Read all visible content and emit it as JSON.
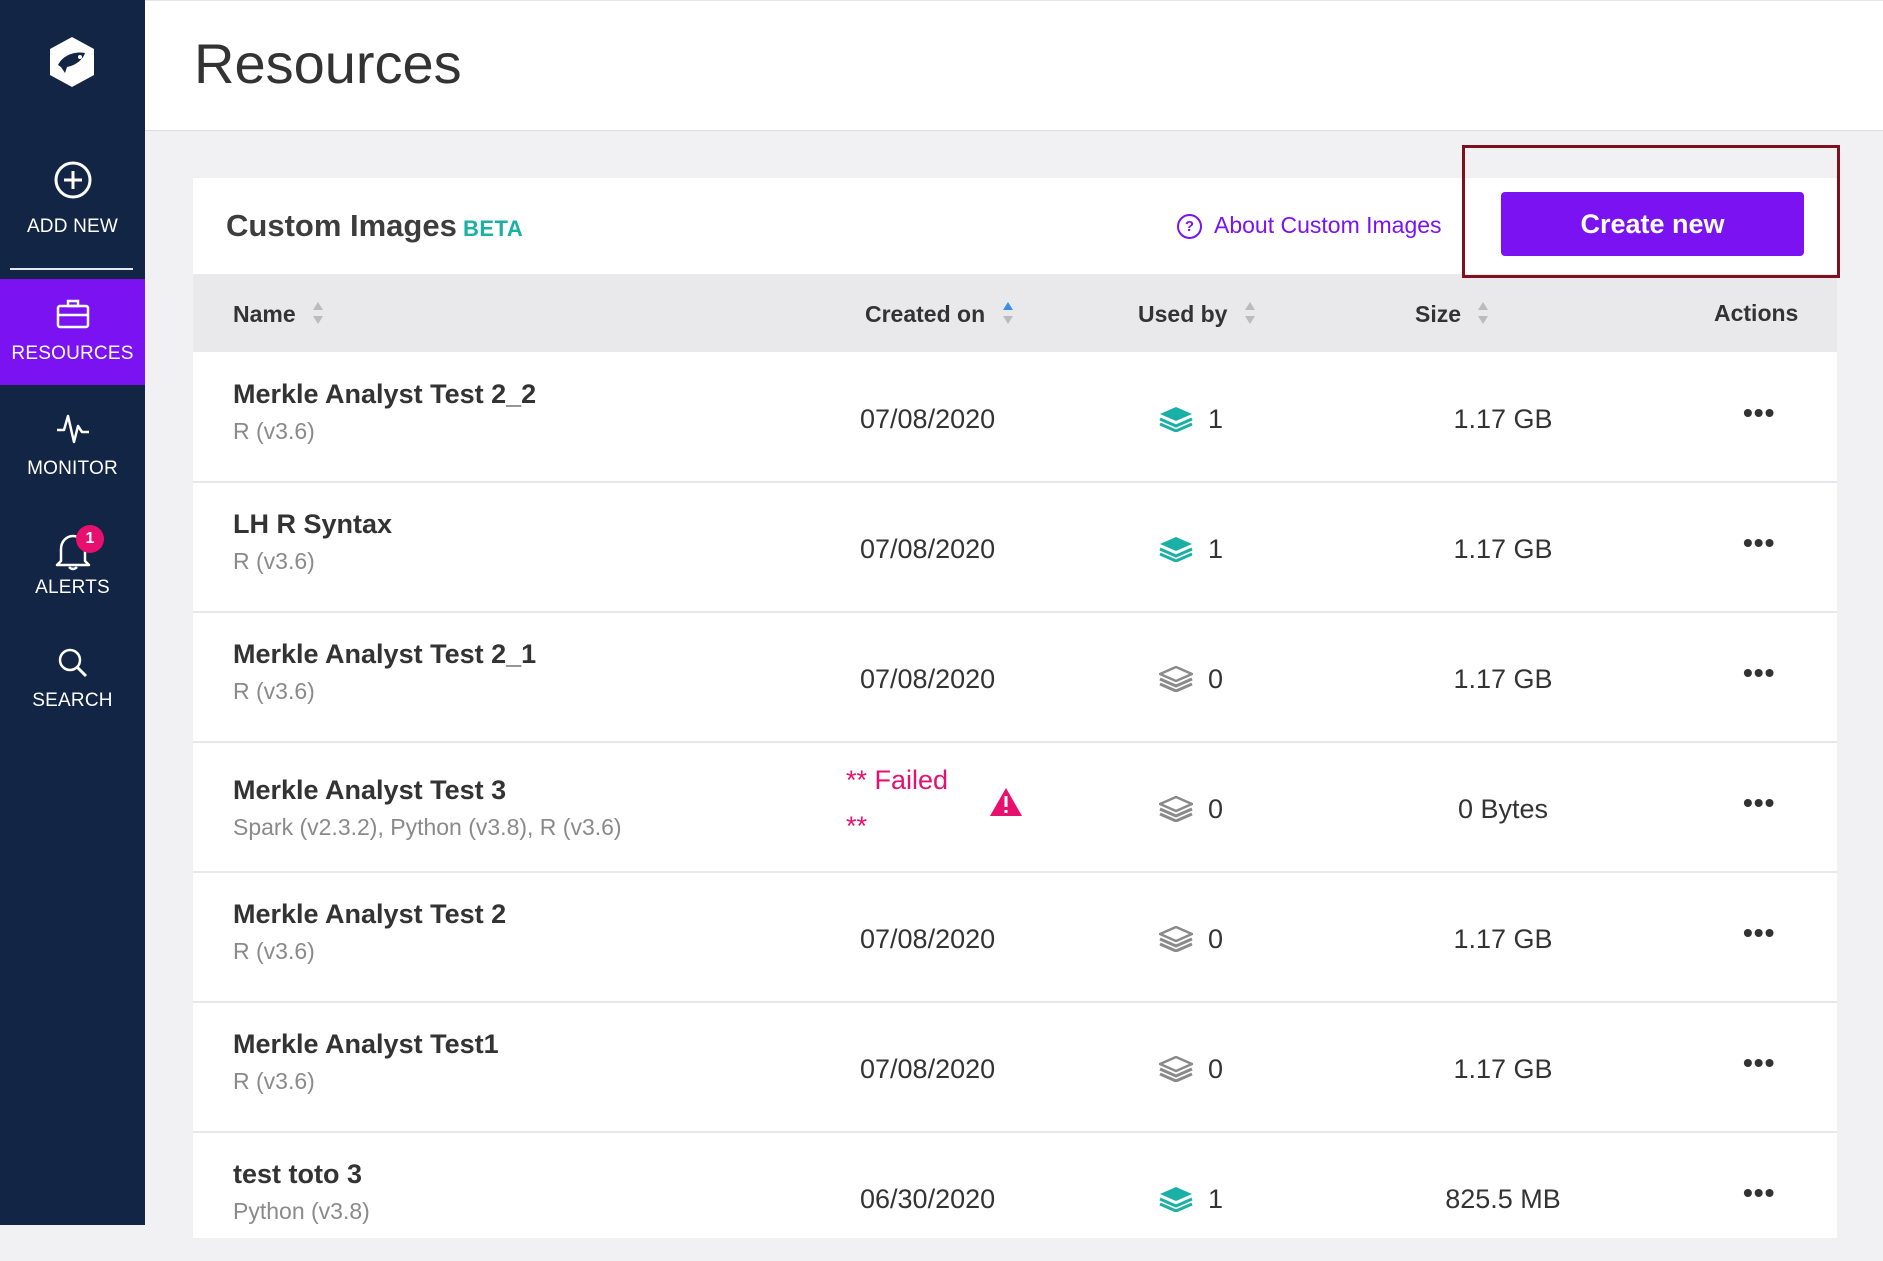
{
  "sidebar": {
    "items": [
      {
        "label": "ADD NEW",
        "icon": "plus-circle-icon"
      },
      {
        "label": "RESOURCES",
        "icon": "briefcase-icon",
        "active": true
      },
      {
        "label": "MONITOR",
        "icon": "pulse-icon"
      },
      {
        "label": "ALERTS",
        "icon": "bell-icon",
        "badge": "1"
      },
      {
        "label": "SEARCH",
        "icon": "search-icon"
      }
    ]
  },
  "header": {
    "title": "Resources"
  },
  "card": {
    "title": "Custom Images",
    "badge": "BETA",
    "about_link": "About Custom Images",
    "create_button": "Create new"
  },
  "table": {
    "columns": [
      "Name",
      "Created on",
      "Used by",
      "Size",
      "Actions"
    ],
    "rows": [
      {
        "name": "Merkle Analyst Test 2_2",
        "sub": "R (v3.6)",
        "created": "07/08/2020",
        "used_by": "1",
        "in_use": true,
        "size": "1.17 GB",
        "actions": "•••"
      },
      {
        "name": "LH R Syntax",
        "sub": "R (v3.6)",
        "created": "07/08/2020",
        "used_by": "1",
        "in_use": true,
        "size": "1.17 GB",
        "actions": "•••"
      },
      {
        "name": "Merkle Analyst Test 2_1",
        "sub": "R (v3.6)",
        "created": "07/08/2020",
        "used_by": "0",
        "in_use": false,
        "size": "1.17 GB",
        "actions": "•••"
      },
      {
        "name": "Merkle Analyst Test 3",
        "sub": "Spark (v2.3.2), Python (v3.8), R (v3.6)",
        "created": "",
        "status_line1": "** Failed",
        "status_line2": "**",
        "used_by": "0",
        "in_use": false,
        "size": "0 Bytes",
        "actions": "•••"
      },
      {
        "name": "Merkle Analyst Test 2",
        "sub": "R (v3.6)",
        "created": "07/08/2020",
        "used_by": "0",
        "in_use": false,
        "size": "1.17 GB",
        "actions": "•••"
      },
      {
        "name": "Merkle Analyst Test1",
        "sub": "R (v3.6)",
        "created": "07/08/2020",
        "used_by": "0",
        "in_use": false,
        "size": "1.17 GB",
        "actions": "•••"
      },
      {
        "name": "test toto 3",
        "sub": "Python (v3.8)",
        "created": "06/30/2020",
        "used_by": "1",
        "in_use": true,
        "size": "825.5 MB",
        "actions": "•••"
      }
    ]
  },
  "colors": {
    "sidebar_bg": "#122544",
    "accent": "#7b12f2",
    "teal": "#1bb0a5",
    "error": "#e8106e",
    "highlight_border": "#7f1020"
  }
}
